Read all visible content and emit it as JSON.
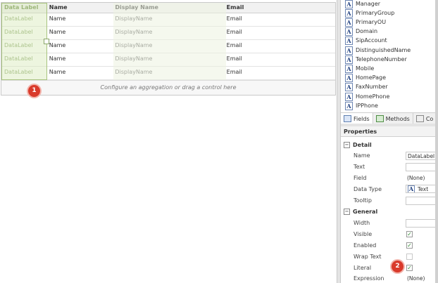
{
  "grid": {
    "headers": [
      "Data Label",
      "Name",
      "Display Name",
      "Email"
    ],
    "rows": [
      [
        "DataLabel",
        "Name",
        "DisplayName",
        "Email"
      ],
      [
        "DataLabel",
        "Name",
        "DisplayName",
        "Email"
      ],
      [
        "DataLabel",
        "Name",
        "DisplayName",
        "Email"
      ],
      [
        "DataLabel",
        "Name",
        "DisplayName",
        "Email"
      ],
      [
        "DataLabel",
        "Name",
        "DisplayName",
        "Email"
      ]
    ],
    "aggregation_hint": "Configure an aggregation or drag a control here"
  },
  "badges": {
    "b1": "1",
    "b2": "2"
  },
  "fields": {
    "items": [
      "Manager",
      "PrimaryGroup",
      "PrimaryOU",
      "Domain",
      "SipAccount",
      "DistinguishedName",
      "TelephoneNumber",
      "Mobile",
      "HomePage",
      "FaxNumber",
      "HomePhone",
      "IPPhone"
    ],
    "icon_glyph": "A"
  },
  "tabs": {
    "fields": "Fields",
    "methods": "Methods",
    "controls": "Co"
  },
  "properties": {
    "title": "Properties",
    "detail": {
      "section": "Detail",
      "name_label": "Name",
      "name_value": "DataLabel",
      "text_label": "Text",
      "text_value": "",
      "field_label": "Field",
      "field_value": "(None)",
      "datatype_label": "Data Type",
      "datatype_value": "Text",
      "datatype_icon": "A",
      "tooltip_label": "Tooltip",
      "tooltip_value": ""
    },
    "general": {
      "section": "General",
      "width_label": "Width",
      "width_value": "",
      "visible_label": "Visible",
      "visible": true,
      "enabled_label": "Enabled",
      "enabled": true,
      "wraptext_label": "Wrap Text",
      "wraptext": false,
      "literal_label": "Literal",
      "literal": true,
      "expression_label": "Expression",
      "expression_value": "(None)"
    },
    "check_glyph": "✓",
    "collapse_glyph": "−"
  },
  "colors": {
    "selection": "#d6e8b8",
    "badge": "#d93a2b"
  }
}
